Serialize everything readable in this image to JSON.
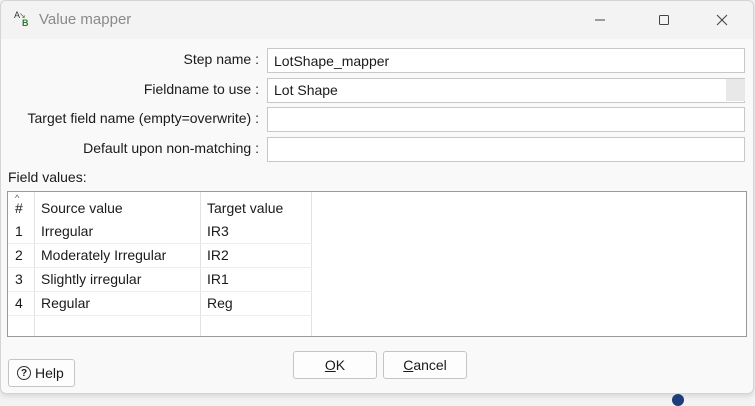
{
  "window": {
    "title": "Value mapper"
  },
  "form": {
    "step_name": {
      "label": "Step name :",
      "value": "LotShape_mapper"
    },
    "fieldname": {
      "label": "Fieldname to use :",
      "value": "Lot Shape"
    },
    "target_field": {
      "label": "Target field name (empty=overwrite) :",
      "value": ""
    },
    "default_value": {
      "label": "Default upon non-matching :",
      "value": ""
    }
  },
  "field_values": {
    "label": "Field values:",
    "columns": [
      "#",
      "Source value",
      "Target value"
    ],
    "rows": [
      {
        "num": "1",
        "source": "Irregular",
        "target": "IR3"
      },
      {
        "num": "2",
        "source": "Moderately Irregular",
        "target": "IR2"
      },
      {
        "num": "3",
        "source": "Slightly irregular",
        "target": "IR1"
      },
      {
        "num": "4",
        "source": "Regular",
        "target": "Reg"
      }
    ]
  },
  "buttons": {
    "ok_first": "O",
    "ok_rest": "K",
    "cancel_first": "C",
    "cancel_rest": "ancel",
    "help": "Help"
  }
}
